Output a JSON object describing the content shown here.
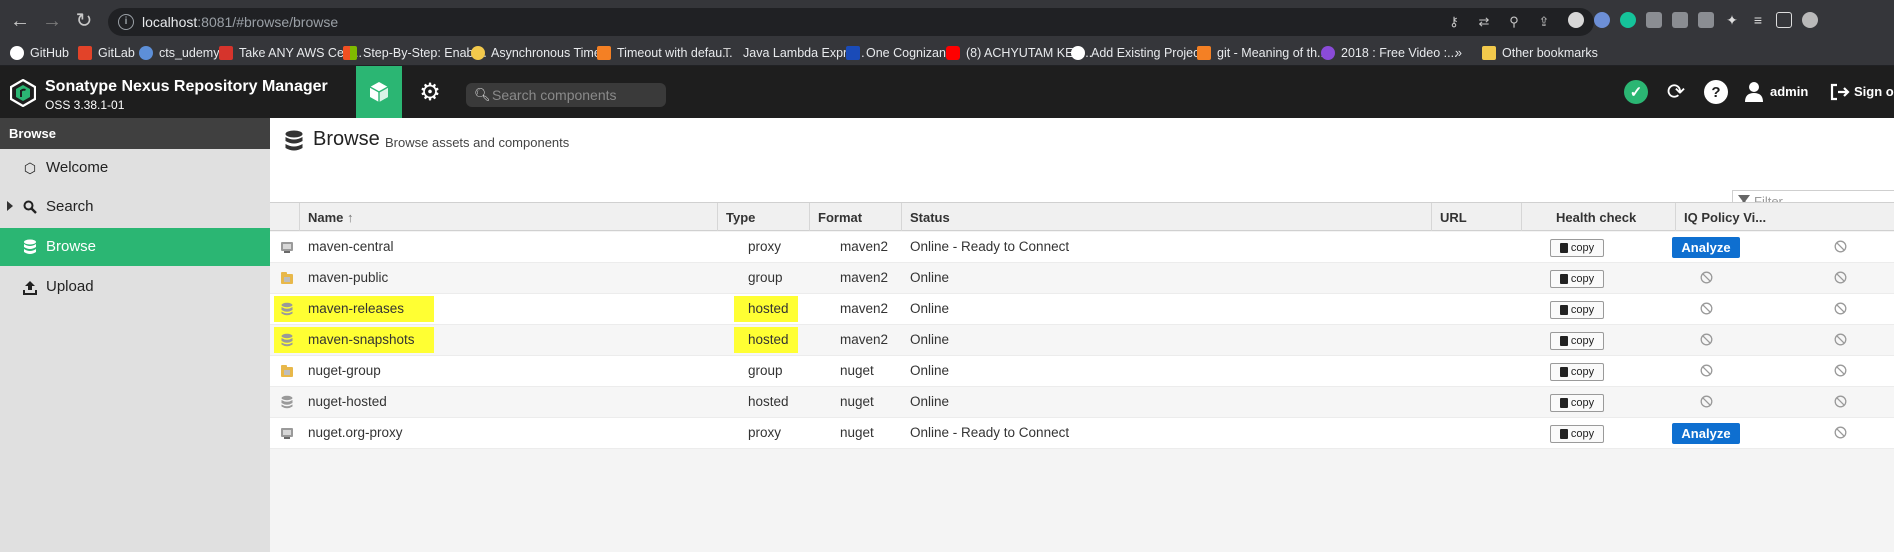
{
  "browser": {
    "url_host": "localhost",
    "url_path": ":8081/#browse/browse",
    "bookmarks": [
      {
        "label": "GitHub",
        "color": "#ffffff"
      },
      {
        "label": "GitLab",
        "color": "#e24329"
      },
      {
        "label": "cts_udemy",
        "color": "#5d8fd8"
      },
      {
        "label": "Take ANY AWS Cert...",
        "color": "#d6342c"
      },
      {
        "label": "Step-By-Step: Enabl...",
        "color": "#f25022"
      },
      {
        "label": "Asynchronous Time...",
        "color": "#f2c94c"
      },
      {
        "label": "Timeout with defau...",
        "color": "#f48024"
      },
      {
        "label": "Java Lambda Expre...",
        "color": "#cccccc"
      },
      {
        "label": "One Cognizant",
        "color": "#1a4bb8"
      },
      {
        "label": "(8) ACHYUTAM KES...",
        "color": "#ff0000"
      },
      {
        "label": "Add Existing Projec...",
        "color": "#ffffff"
      },
      {
        "label": "git - Meaning of th...",
        "color": "#f48024"
      },
      {
        "label": "2018 : Free Video :...",
        "color": "#8a4bd8"
      },
      {
        "label": "»",
        "color": ""
      },
      {
        "label": "Other bookmarks",
        "color": "#f2c94c"
      }
    ]
  },
  "header": {
    "title": "Sonatype Nexus Repository Manager",
    "version": "OSS 3.38.1-01",
    "search_placeholder": "Search components",
    "user": "admin",
    "signout": "Sign out",
    "colors": {
      "accent": "#2bb673",
      "bar": "#1e1e1e"
    }
  },
  "sidebar": {
    "heading": "Browse",
    "items": [
      {
        "label": "Welcome",
        "icon": "hexagon-icon"
      },
      {
        "label": "Search",
        "icon": "search-icon"
      },
      {
        "label": "Browse",
        "icon": "database-icon",
        "active": true
      },
      {
        "label": "Upload",
        "icon": "upload-icon"
      }
    ]
  },
  "page": {
    "title": "Browse",
    "subtitle": "Browse assets and components",
    "filter_placeholder": "Filter"
  },
  "table": {
    "columns": [
      "Name",
      "Type",
      "Format",
      "Status",
      "URL",
      "Health check",
      "IQ Policy Vi..."
    ],
    "sort_indicator": "↑",
    "copy_label": "copy",
    "analyze_label": "Analyze",
    "rows": [
      {
        "name": "maven-central",
        "type": "proxy",
        "format": "maven2",
        "status": "Online - Ready to Connect",
        "icon": "proxy-repo-icon",
        "health": "analyze",
        "highlight": false
      },
      {
        "name": "maven-public",
        "type": "group",
        "format": "maven2",
        "status": "Online",
        "icon": "group-repo-icon",
        "health": "none",
        "highlight": false
      },
      {
        "name": "maven-releases",
        "type": "hosted",
        "format": "maven2",
        "status": "Online",
        "icon": "hosted-repo-icon",
        "health": "none",
        "highlight": true
      },
      {
        "name": "maven-snapshots",
        "type": "hosted",
        "format": "maven2",
        "status": "Online",
        "icon": "hosted-repo-icon",
        "health": "none",
        "highlight": true
      },
      {
        "name": "nuget-group",
        "type": "group",
        "format": "nuget",
        "status": "Online",
        "icon": "group-repo-icon",
        "health": "none",
        "highlight": false
      },
      {
        "name": "nuget-hosted",
        "type": "hosted",
        "format": "nuget",
        "status": "Online",
        "icon": "hosted-repo-icon",
        "health": "none",
        "highlight": false
      },
      {
        "name": "nuget.org-proxy",
        "type": "proxy",
        "format": "nuget",
        "status": "Online - Ready to Connect",
        "icon": "proxy-repo-icon",
        "health": "analyze",
        "highlight": false
      }
    ]
  }
}
